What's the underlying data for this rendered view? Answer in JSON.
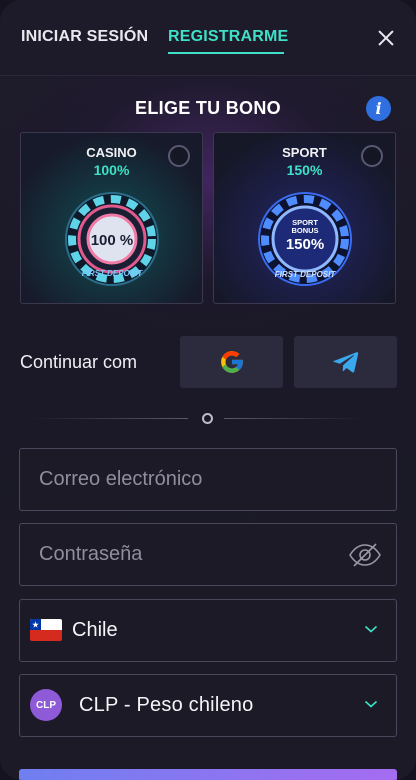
{
  "header": {
    "tabs": [
      {
        "label": "INICIAR SESIÓN",
        "active": false
      },
      {
        "label": "REGISTRARME",
        "active": true
      }
    ],
    "close_icon": "close-icon"
  },
  "bonus": {
    "title": "ELIGE TU BONO",
    "info_icon": "i",
    "options": [
      {
        "label": "CASINO",
        "percent": "100%",
        "chip_text": "100 %",
        "chip_ring_text": "FIRST DEPOSIT",
        "selected": false
      },
      {
        "label": "SPORT",
        "percent": "150%",
        "chip_line1": "SPORT",
        "chip_line2": "BONUS",
        "chip_text": "150%",
        "chip_ring_text": "FIRST DEPOSIT",
        "selected": false
      }
    ]
  },
  "social": {
    "label": "Continuar com",
    "providers": [
      {
        "name": "google",
        "icon": "google-icon"
      },
      {
        "name": "telegram",
        "icon": "telegram-icon"
      }
    ]
  },
  "form": {
    "email_placeholder": "Correo electrónico",
    "password_placeholder": "Contraseña",
    "country": {
      "value": "Chile",
      "flag": "chile-flag-icon"
    },
    "currency": {
      "value": "CLP - Peso chileno",
      "badge": "CLP"
    }
  },
  "colors": {
    "accent": "#3ee0c7",
    "info": "#2f6fe0",
    "currency_badge": "#8e5ad7",
    "button_gradient_start": "#6f7ff0",
    "button_gradient_end": "#a56cf0"
  }
}
